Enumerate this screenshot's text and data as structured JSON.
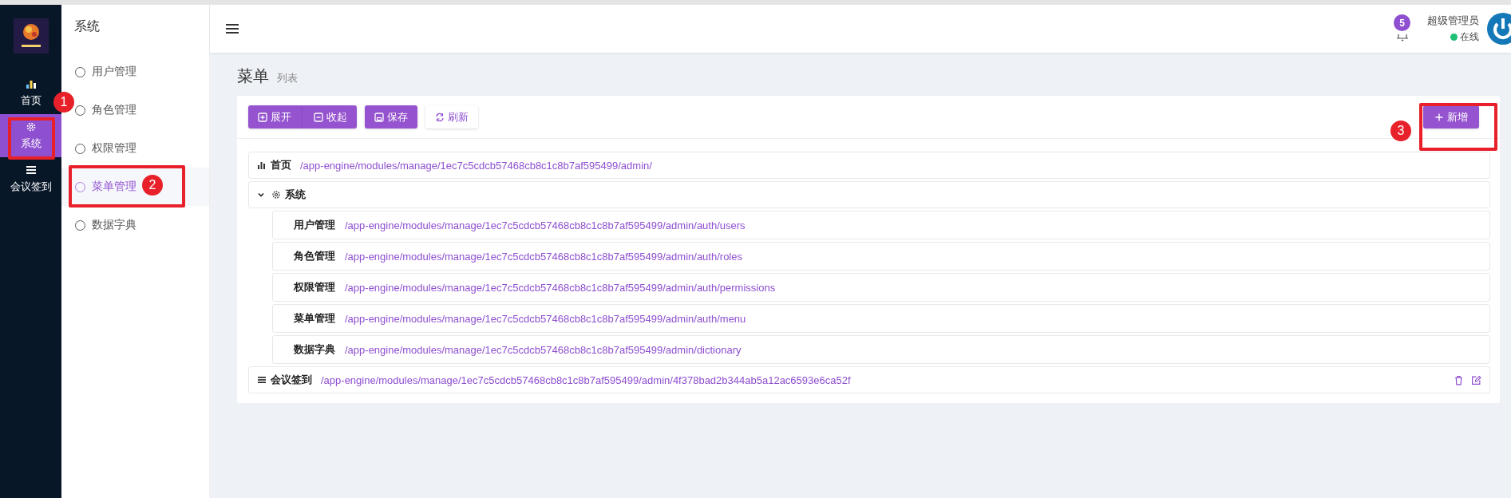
{
  "header": {
    "notification_count": "5",
    "user_name": "超级管理员",
    "status": "在线",
    "online": true
  },
  "nav": [
    {
      "label": "首页",
      "kind": "chart",
      "selected": false
    },
    {
      "label": "系统",
      "kind": "gear",
      "selected": true
    },
    {
      "label": "会议签到",
      "kind": "list",
      "selected": false
    }
  ],
  "submenu": {
    "title": "系统",
    "items": [
      {
        "label": "用户管理",
        "selected": false
      },
      {
        "label": "角色管理",
        "selected": false
      },
      {
        "label": "权限管理",
        "selected": false
      },
      {
        "label": "菜单管理",
        "selected": true
      },
      {
        "label": "数据字典",
        "selected": false
      }
    ]
  },
  "page": {
    "title": "菜单",
    "subtitle": "列表"
  },
  "toolbar": {
    "buttons": [
      {
        "label": "展开",
        "kind": "expand"
      },
      {
        "label": "收起",
        "kind": "collapse"
      },
      {
        "label": "保存",
        "kind": "save"
      },
      {
        "label": "刷新",
        "kind": "refresh"
      }
    ],
    "add_label": "新增"
  },
  "tree": [
    {
      "label": "首页",
      "kind": "chart",
      "path": "/app-engine/modules/manage/1ec7c5cdcb57468cb8c1c8b7af595499/admin/",
      "actions": false
    },
    {
      "label": "系统",
      "kind": "gear",
      "expanded": true,
      "actions": false,
      "children": [
        {
          "label": "用户管理",
          "path": "/app-engine/modules/manage/1ec7c5cdcb57468cb8c1c8b7af595499/admin/auth/users"
        },
        {
          "label": "角色管理",
          "path": "/app-engine/modules/manage/1ec7c5cdcb57468cb8c1c8b7af595499/admin/auth/roles"
        },
        {
          "label": "权限管理",
          "path": "/app-engine/modules/manage/1ec7c5cdcb57468cb8c1c8b7af595499/admin/auth/permissions"
        },
        {
          "label": "菜单管理",
          "path": "/app-engine/modules/manage/1ec7c5cdcb57468cb8c1c8b7af595499/admin/auth/menu"
        },
        {
          "label": "数据字典",
          "path": "/app-engine/modules/manage/1ec7c5cdcb57468cb8c1c8b7af595499/admin/dictionary"
        }
      ]
    },
    {
      "label": "会议签到",
      "kind": "list",
      "path": "/app-engine/modules/manage/1ec7c5cdcb57468cb8c1c8b7af595499/admin/4f378bad2b344ab5a12ac6593e6ca52f",
      "actions": true
    }
  ],
  "annotations": [
    {
      "label": "1"
    },
    {
      "label": "2"
    },
    {
      "label": "3"
    }
  ]
}
